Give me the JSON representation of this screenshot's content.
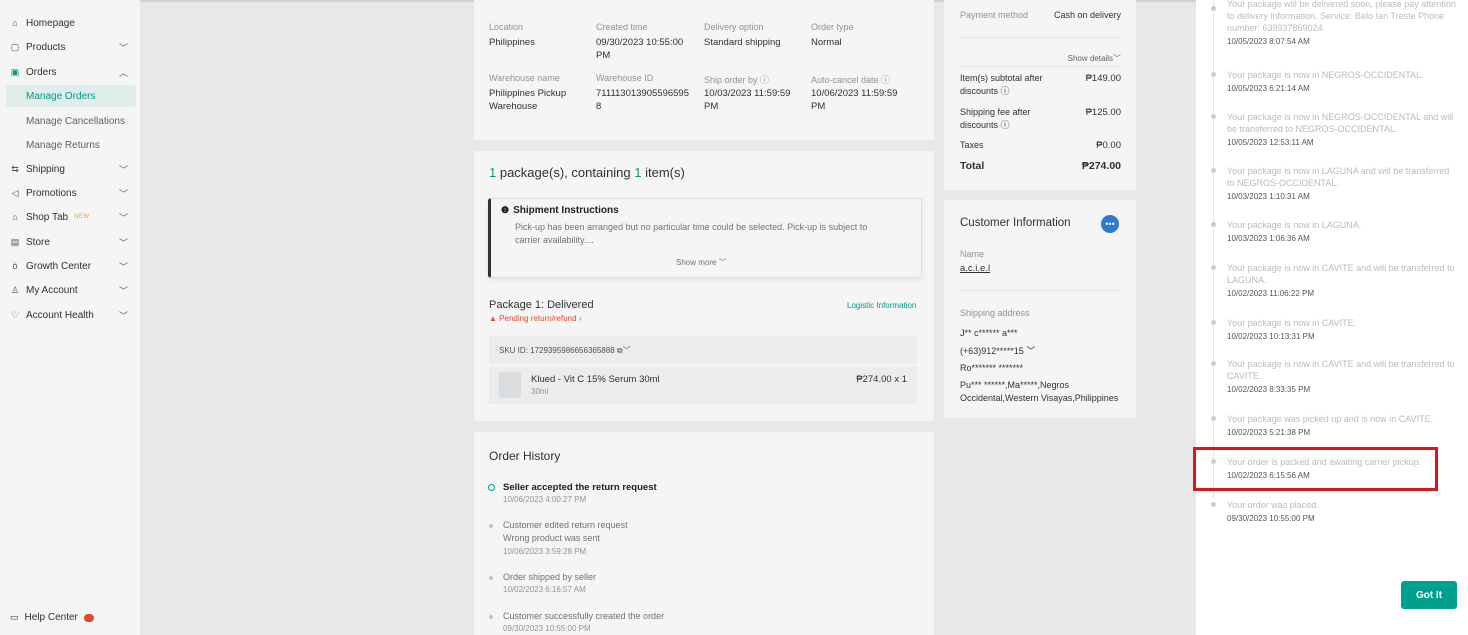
{
  "sidebar": {
    "items": [
      {
        "label": "Homepage",
        "icon": "home-icon"
      },
      {
        "label": "Products",
        "icon": "box-icon"
      },
      {
        "label": "Orders",
        "icon": "clipboard-icon"
      },
      {
        "label": "Shipping",
        "icon": "truck-icon"
      },
      {
        "label": "Promotions",
        "icon": "megaphone-icon"
      },
      {
        "label": "Shop Tab",
        "icon": "shop-icon",
        "badge": "NEW"
      },
      {
        "label": "Store",
        "icon": "store-icon"
      },
      {
        "label": "Growth Center",
        "icon": "growth-icon"
      },
      {
        "label": "My Account",
        "icon": "user-icon"
      },
      {
        "label": "Account Health",
        "icon": "shield-icon"
      }
    ],
    "orders_sub": [
      "Manage Orders",
      "Manage Cancellations",
      "Manage Returns"
    ],
    "help": "Help Center"
  },
  "order_info": {
    "location_label": "Location",
    "location": "Philippines",
    "created_label": "Created time",
    "created": "09/30/2023 10:55:00 PM",
    "delivery_label": "Delivery option",
    "delivery": "Standard shipping",
    "type_label": "Order type",
    "type": "Normal",
    "warehouse_label": "Warehouse name",
    "warehouse": "Philippines Pickup Warehouse",
    "wid_label": "Warehouse ID",
    "wid": "711113013905596595 8",
    "ship_by_label": "Ship order by",
    "ship_by": "10/03/2023 11:59:59 PM",
    "cancel_label": "Auto-cancel date",
    "cancel": "10/06/2023 11:59:59 PM"
  },
  "package": {
    "count": "1",
    "mid": " package(s), containing ",
    "items": "1",
    "end": " item(s)",
    "instr_title": "Shipment Instructions",
    "instr_text": "Pick-up has been arranged but no particular time could be selected. Pick-up is subject to carrier availability....",
    "show_more": "Show more",
    "pkg_title": "Package 1: Delivered",
    "pending": "Pending return/refund",
    "logistic": "Logistic Information",
    "sku": "SKU ID: 1729395986656365888",
    "product": "Klued - Vit C 15% Serum 30ml",
    "variant": "30ml",
    "price": "₱274.00 x 1"
  },
  "history": {
    "title": "Order History",
    "events": [
      {
        "text": "Seller accepted the return request",
        "time": "10/06/2023 4:00:27 PM"
      },
      {
        "text": "Customer edited return request",
        "sub": "Wrong product was sent",
        "time": "10/06/2023 3:59:28 PM"
      },
      {
        "text": "Order shipped by seller",
        "time": "10/02/2023 6:16:57 AM"
      },
      {
        "text": "Customer successfully created the order",
        "time": "09/30/2023 10:55:00 PM"
      }
    ]
  },
  "payment": {
    "method_label": "Payment method",
    "method": "Cash on delivery",
    "show_details": "Show details",
    "subtotal_label": "Item(s) subtotal after discounts",
    "subtotal": "₱149.00",
    "shipping_label": "Shipping fee after discounts",
    "shipping": "₱125.00",
    "taxes_label": "Taxes",
    "taxes": "₱0.00",
    "total_label": "Total",
    "total": "₱274.00"
  },
  "customer": {
    "title": "Customer Information",
    "name_label": "Name",
    "name": "a.c.i.e.l",
    "addr_label": "Shipping address",
    "addr1": "J** c****** a***",
    "phone": "(+63)912*****15",
    "addr2": "Ro******* *******",
    "addr3": "Pu*** ******,Ma*****,Negros Occidental,Western Visayas,Philippines"
  },
  "tracking": {
    "events": [
      {
        "text": "Your package will be delivered soon, please pay attention to delivery information. Service: Belo Ian Treste Phone number: 639937869024",
        "time": "10/05/2023 8:07:54 AM"
      },
      {
        "text": "Your package is now in NEGROS-OCCIDENTAL.",
        "time": "10/05/2023 6:21:14 AM"
      },
      {
        "text": "Your package is now in NEGROS-OCCIDENTAL and will be transferred to NEGROS-OCCIDENTAL.",
        "time": "10/05/2023 12:53:11 AM"
      },
      {
        "text": "Your package is now in LAGUNA and will be transferred to NEGROS-OCCIDENTAL.",
        "time": "10/03/2023 1:10:31 AM"
      },
      {
        "text": "Your package is now in LAGUNA.",
        "time": "10/03/2023 1:06:36 AM"
      },
      {
        "text": "Your package is now in CAVITE and will be transferred to LAGUNA.",
        "time": "10/02/2023 11:06:22 PM"
      },
      {
        "text": "Your package is now in CAVITE.",
        "time": "10/02/2023 10:13:31 PM"
      },
      {
        "text": "Your package is now in CAVITE and will be transferred to CAVITE.",
        "time": "10/02/2023 8:33:35 PM"
      },
      {
        "text": "Your package was picked up and is now in CAVITE.",
        "time": "10/02/2023 5:21:38 PM"
      },
      {
        "text": "Your order is packed and awaiting carrier pickup.",
        "time": "10/02/2023 6:15:56 AM"
      },
      {
        "text": "Your order was placed.",
        "time": "09/30/2023 10:55:00 PM"
      }
    ],
    "button": "Got It"
  },
  "colors": {
    "accent": "#00a08e",
    "highlight": "#e0121b",
    "warning": "#ee4d2d"
  }
}
